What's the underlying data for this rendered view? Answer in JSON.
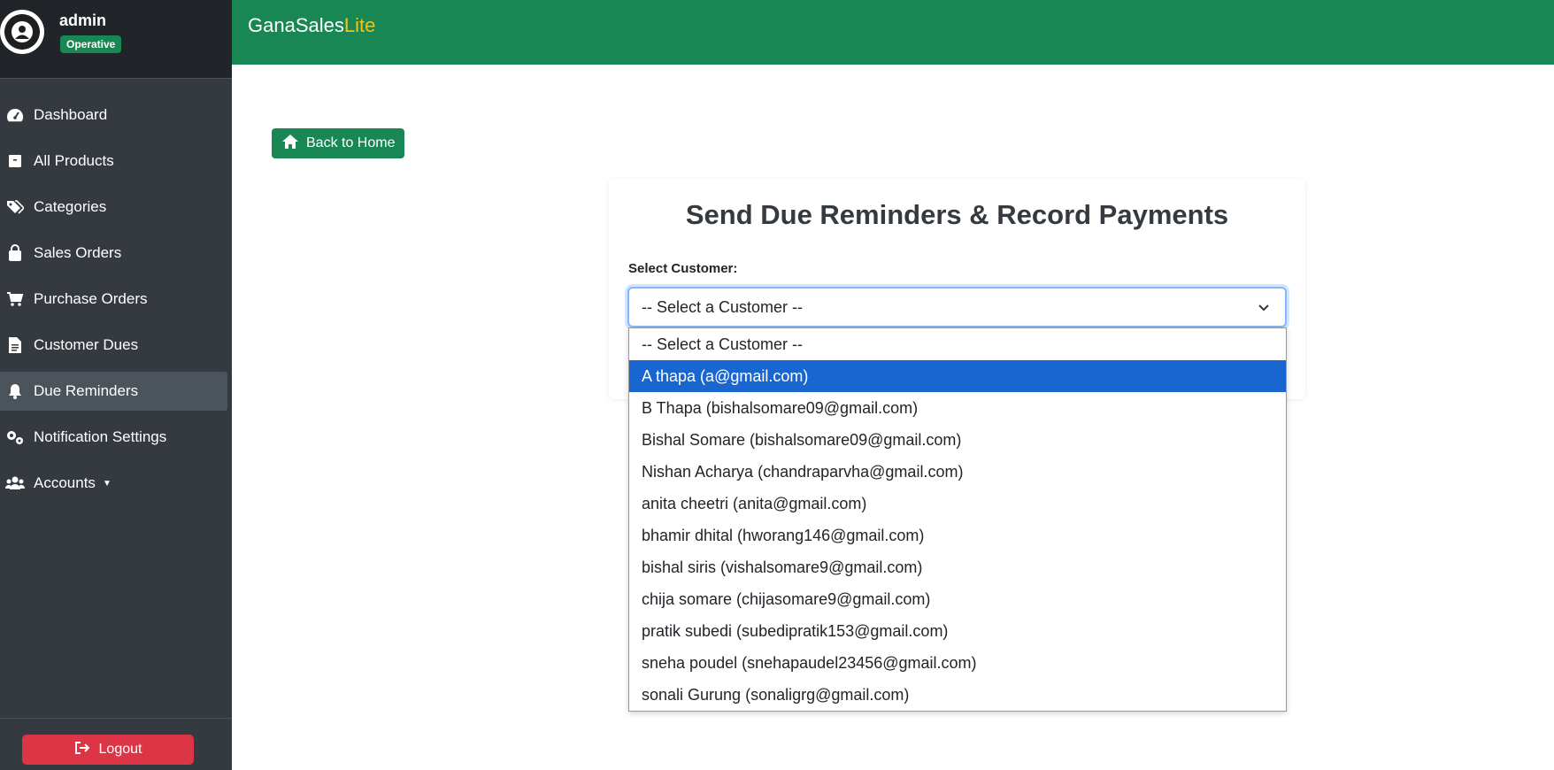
{
  "app": {
    "brand_main": "GanaSales",
    "brand_accent": "Lite"
  },
  "user": {
    "name": "admin",
    "badge": "Operative"
  },
  "sidebar": {
    "items": [
      {
        "label": "Dashboard",
        "icon": "gauge-icon"
      },
      {
        "label": "All Products",
        "icon": "box-icon"
      },
      {
        "label": "Categories",
        "icon": "tags-icon"
      },
      {
        "label": "Sales Orders",
        "icon": "shopping-bag-icon"
      },
      {
        "label": "Purchase Orders",
        "icon": "cart-icon"
      },
      {
        "label": "Customer Dues",
        "icon": "document-icon"
      },
      {
        "label": "Due Reminders",
        "icon": "bell-icon",
        "active": true
      },
      {
        "label": "Notification Settings",
        "icon": "gears-icon"
      },
      {
        "label": "Accounts",
        "icon": "users-icon",
        "has_dropdown": true
      }
    ],
    "logout_label": "Logout"
  },
  "main": {
    "back_label": "Back to Home",
    "title": "Send Due Reminders & Record Payments",
    "select_label": "Select Customer:",
    "select_value": "-- Select a Customer --",
    "options": [
      "-- Select a Customer --",
      "A thapa (a@gmail.com)",
      "B Thapa (bishalsomare09@gmail.com)",
      "Bishal Somare (bishalsomare09@gmail.com)",
      "Nishan Acharya (chandraparvha@gmail.com)",
      "anita cheetri (anita@gmail.com)",
      "bhamir dhital (hworang146@gmail.com)",
      "bishal siris (vishalsomare9@gmail.com)",
      "chija somare (chijasomare9@gmail.com)",
      "pratik subedi (subedipratik153@gmail.com)",
      "sneha poudel (snehapaudel23456@gmail.com)",
      "sonali Gurung (sonaligrg@gmail.com)"
    ],
    "highlighted_option": "A thapa (a@gmail.com)"
  },
  "colors": {
    "primary_green": "#198754",
    "brand_accent": "#ffc107",
    "sidebar_bg": "#343a40",
    "danger": "#dc3545",
    "highlight": "#1a66d0"
  }
}
